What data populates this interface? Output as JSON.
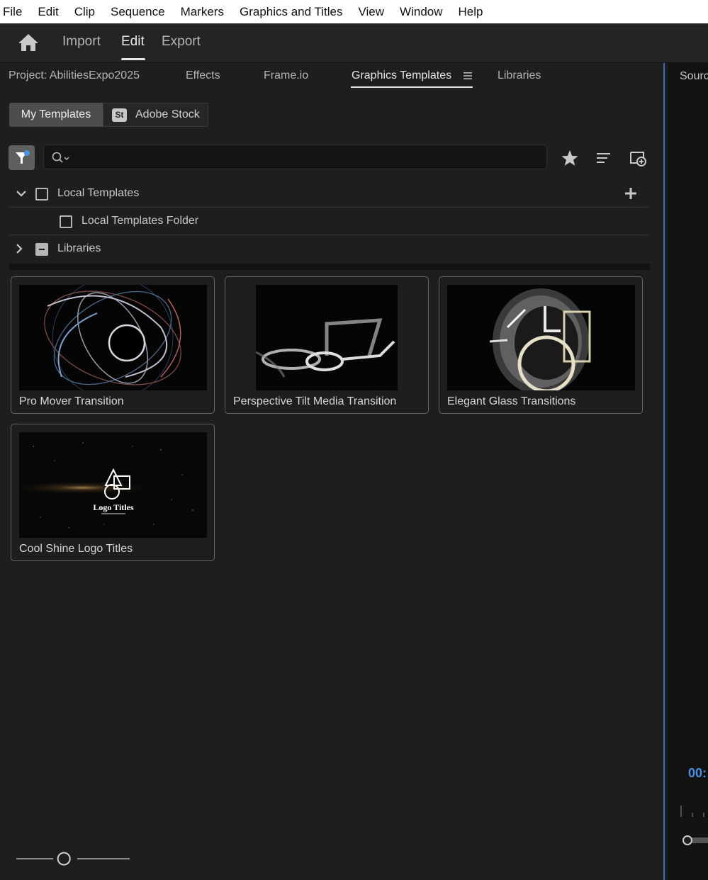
{
  "menu_bar": [
    "File",
    "Edit",
    "Clip",
    "Sequence",
    "Markers",
    "Graphics and Titles",
    "View",
    "Window",
    "Help"
  ],
  "workspaces": {
    "import": "Import",
    "edit": "Edit",
    "export": "Export"
  },
  "panel_tabs": {
    "project": "Project: AbilitiesExpo2025",
    "effects": "Effects",
    "frameio": "Frame.io",
    "graphics_templates": "Graphics Templates",
    "libraries": "Libraries"
  },
  "source_toggle": {
    "my_templates": "My Templates",
    "adobe_stock": "Adobe Stock",
    "stock_badge": "St"
  },
  "search": {
    "placeholder": "",
    "value": ""
  },
  "tree": {
    "local_templates": "Local Templates",
    "local_templates_folder": "Local Templates Folder",
    "libraries": "Libraries"
  },
  "templates": [
    {
      "title": "Pro Mover Transition"
    },
    {
      "title": "Perspective Tilt Media Transition"
    },
    {
      "title": "Elegant Glass Transitions"
    },
    {
      "title": "Cool Shine Logo Titles",
      "thumb_text": "Logo Titles"
    }
  ],
  "thumbnail_zoom": 0.42,
  "right_panel": {
    "title": "Sourc",
    "timecode": "00:"
  },
  "colors": {
    "accent": "#3a6bb0",
    "timecode": "#4a90e2",
    "active_segment": "#4d4d4d",
    "panel_bg": "#1e1e1e"
  },
  "icons": [
    "home-icon",
    "hamburger-menu-icon",
    "filter-icon",
    "search-icon",
    "star-icon",
    "sort-icon",
    "new-bin-icon",
    "chevron-down-icon",
    "chevron-right-icon",
    "plus-icon",
    "zoom-slider-handle"
  ]
}
